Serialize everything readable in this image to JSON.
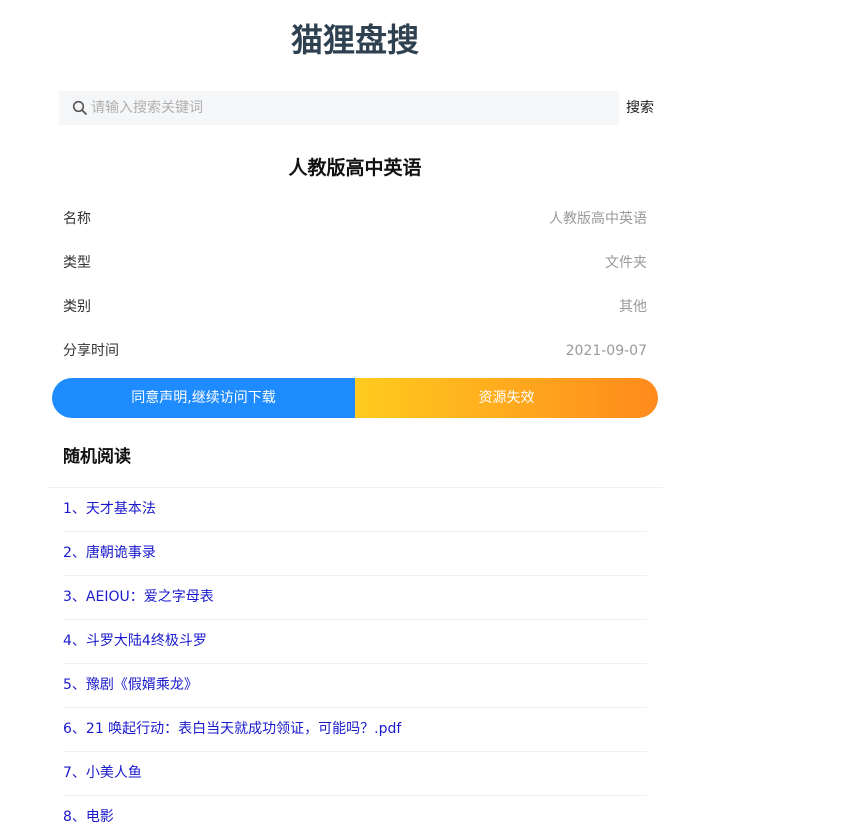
{
  "site": {
    "logo_text": "猫狸盘搜"
  },
  "search": {
    "placeholder": "请输入搜索关键词",
    "value": "",
    "button_label": "搜索",
    "icon": "search-icon"
  },
  "detail": {
    "title": "人教版高中英语",
    "rows": [
      {
        "label": "名称",
        "value": "人教版高中英语"
      },
      {
        "label": "类型",
        "value": "文件夹"
      },
      {
        "label": "类别",
        "value": "其他"
      },
      {
        "label": "分享时间",
        "value": "2021-09-07"
      }
    ]
  },
  "actions": {
    "download_label": "同意声明,继续访问下载",
    "invalid_label": "资源失效"
  },
  "random_reading": {
    "title": "随机阅读",
    "items": [
      "1、天才基本法",
      "2、唐朝诡事录",
      "3、AEIOU：爱之字母表",
      "4、斗罗大陆4终极斗罗",
      "5、豫剧《假婿乘龙》",
      "6、21 唤起行动：表白当天就成功领证，可能吗？.pdf",
      "7、小美人鱼",
      "8、电影"
    ]
  },
  "colors": {
    "logo": "#2f4050",
    "primary_blue": "#1e8bff",
    "gradient_start": "#ffcb1f",
    "gradient_end": "#ff8a1c",
    "link": "#1a1acc"
  }
}
